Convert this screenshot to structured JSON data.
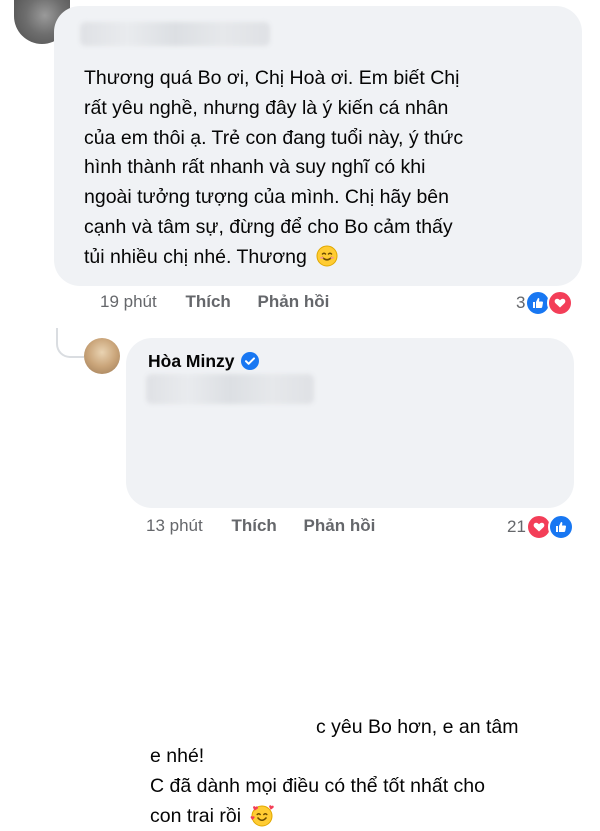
{
  "comment": {
    "text": "Thương quá Bo ơi, Chị Hoà ơi. Em biết Chị\nrất yêu nghề, nhưng đây là ý kiến cá nhân\ncủa em thôi ạ. Trẻ con đang tuổi này, ý thức\nhình thành rất nhanh và suy nghĩ có khi\nngoài tưởng tượng của mình. Chị hãy bên\ncạnh và tâm sự, đừng để cho Bo cảm thấy\ntủi nhiều chị nhé. Thương",
    "emoji": "smiling-face-icon",
    "time": "19 phút",
    "like_label": "Thích",
    "reply_label": "Phản hồi",
    "reaction_count": "3",
    "reactions": [
      "like",
      "love"
    ]
  },
  "reply": {
    "author": "Hòa Minzy",
    "verified": true,
    "text_first_line": "c yêu Bo hơn, e an tâm",
    "text_rest": "e nhé!\nC đã dành mọi điều có thể tốt nhất cho\ncon trai rồi",
    "emoji": "smiling-face-with-hearts-icon",
    "time": "13 phút",
    "like_label": "Thích",
    "reply_label": "Phản hồi",
    "reaction_count": "21",
    "reactions": [
      "love",
      "like"
    ]
  },
  "colors": {
    "bubble": "#f0f2f5",
    "meta_text": "#65676b",
    "like_blue": "#1877f2",
    "love_red": "#f33e58"
  }
}
